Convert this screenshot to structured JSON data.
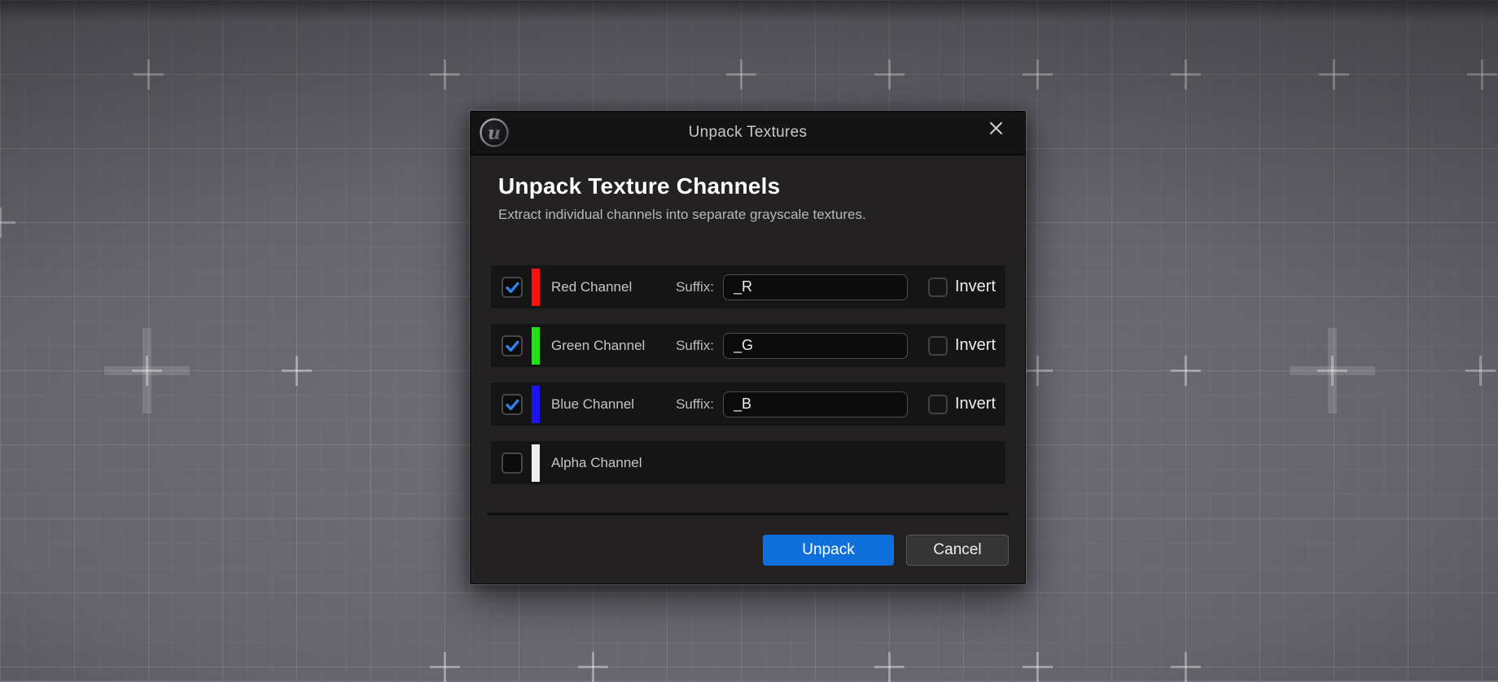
{
  "window": {
    "title": "Unpack Textures"
  },
  "header": {
    "title": "Unpack Texture Channels",
    "subtitle": "Extract individual channels into separate grayscale textures."
  },
  "labels": {
    "suffix": "Suffix:",
    "invert": "Invert"
  },
  "channels": [
    {
      "name": "Red Channel",
      "color": "#ff1010",
      "checked": true,
      "suffix": "_R",
      "invert_checked": false
    },
    {
      "name": "Green Channel",
      "color": "#1de412",
      "checked": true,
      "suffix": "_G",
      "invert_checked": false
    },
    {
      "name": "Blue Channel",
      "color": "#1c12f2",
      "checked": true,
      "suffix": "_B",
      "invert_checked": false
    },
    {
      "name": "Alpha Channel",
      "color": "#efedee",
      "checked": false
    }
  ],
  "footer": {
    "unpack_label": "Unpack",
    "cancel_label": "Cancel"
  },
  "colors": {
    "accent_blue": "#0f70dc",
    "check_blue": "#2e80e6",
    "titlebar_bg": "#151414",
    "dialog_bg": "#232121",
    "row_bg": "#161515"
  }
}
